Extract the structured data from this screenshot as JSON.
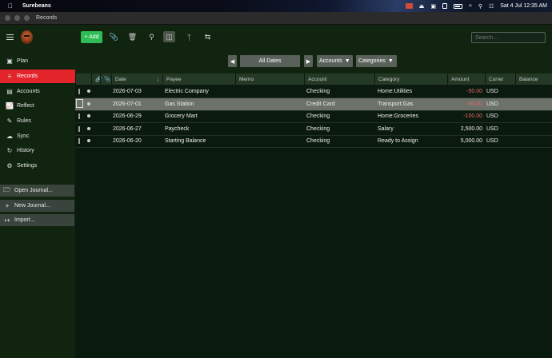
{
  "menubar": {
    "app_name": "Surebeans",
    "datetime": "Sat 4 Jul  12:35 AM"
  },
  "window": {
    "title": "Records"
  },
  "toolbar": {
    "add_label": "+ Add",
    "search_placeholder": "Search..."
  },
  "sidebar": {
    "nav": [
      {
        "label": "Plan",
        "icon": "plan-icon"
      },
      {
        "label": "Records",
        "icon": "records-icon",
        "active": true
      },
      {
        "label": "Accounts",
        "icon": "accounts-icon"
      },
      {
        "label": "Reflect",
        "icon": "reflect-icon"
      },
      {
        "label": "Rules",
        "icon": "rules-icon"
      },
      {
        "label": "Sync",
        "icon": "sync-icon"
      },
      {
        "label": "History",
        "icon": "history-icon"
      },
      {
        "label": "Settings",
        "icon": "settings-icon"
      }
    ],
    "actions": [
      {
        "label": "Open Journal...",
        "icon": "folder-icon"
      },
      {
        "label": "New Journal...",
        "icon": "plus-icon"
      },
      {
        "label": "Import...",
        "icon": "import-icon"
      }
    ]
  },
  "filters": {
    "dates_label": "All Dates",
    "accounts_label": "Accounts",
    "categories_label": "Categories"
  },
  "table": {
    "columns": [
      "Date",
      "Payee",
      "Memo",
      "Account",
      "Category",
      "Amount",
      "Currer",
      "Balance"
    ],
    "rows": [
      {
        "date": "2026-07-03",
        "payee": "Electric Company",
        "memo": "",
        "account": "Checking",
        "category": "Home:Utilities",
        "amount": "-50.00",
        "currency": "USD",
        "balance": ""
      },
      {
        "date": "2026-07-01",
        "payee": "Gas Station",
        "memo": "",
        "account": "Credit Card",
        "category": "Transport:Gas",
        "amount": "-50.00",
        "currency": "USD",
        "balance": "",
        "selected": true
      },
      {
        "date": "2026-06-29",
        "payee": "Grocery Mart",
        "memo": "",
        "account": "Checking",
        "category": "Home:Groceries",
        "amount": "-100.00",
        "currency": "USD",
        "balance": ""
      },
      {
        "date": "2026-06-27",
        "payee": "Paycheck",
        "memo": "",
        "account": "Checking",
        "category": "Salary",
        "amount": "2,500.00",
        "currency": "USD",
        "balance": ""
      },
      {
        "date": "2026-06-20",
        "payee": "Starting Balance",
        "memo": "",
        "account": "Checking",
        "category": "Ready to Assign",
        "amount": "5,000.00",
        "currency": "USD",
        "balance": ""
      }
    ]
  },
  "colors": {
    "accent_red": "#e3242b",
    "add_green": "#2fbc56",
    "negative": "#e06a6a",
    "background": "#0b1a0e"
  }
}
